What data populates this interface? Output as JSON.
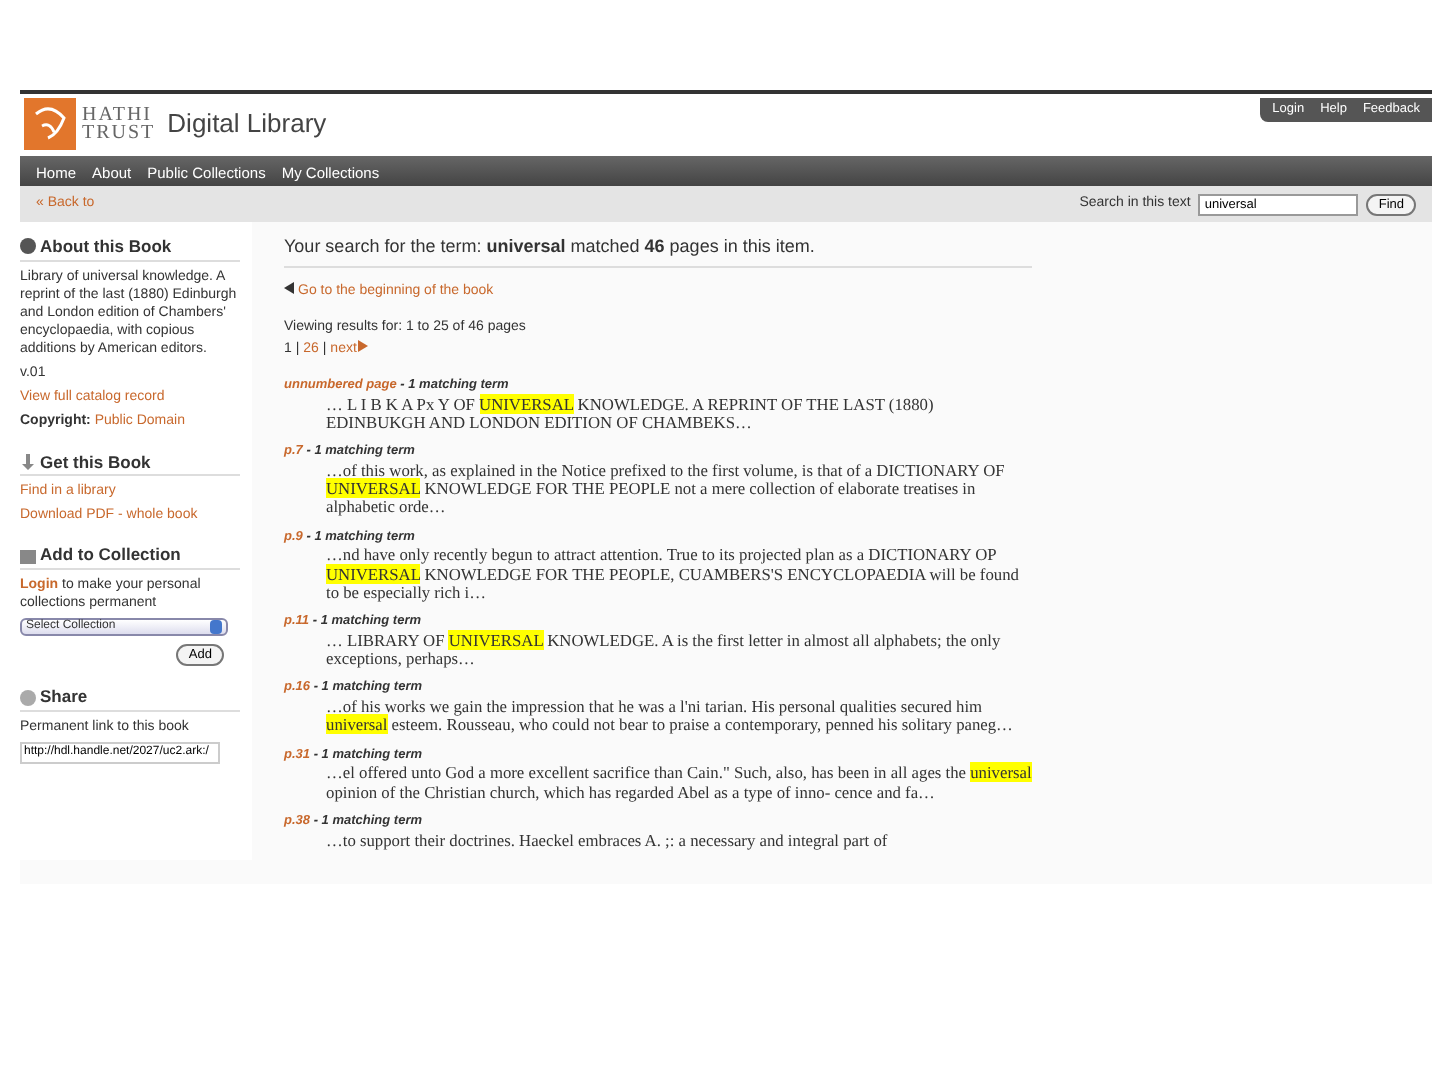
{
  "header": {
    "logo_top": "HATHI",
    "logo_bottom": "TRUST",
    "title": "Digital Library",
    "utility_links": [
      "Login",
      "Help",
      "Feedback"
    ]
  },
  "nav": [
    "Home",
    "About",
    "Public Collections",
    "My Collections"
  ],
  "subbar": {
    "back": "« Back to",
    "search_label": "Search in this text",
    "search_value": "universal",
    "find_button": "Find"
  },
  "sidebar": {
    "about": {
      "heading": "About this Book",
      "description": "Library of universal knowledge. A reprint of the last (1880) Edinburgh and London edition of Chambers' encyclopaedia, with copious additions by American editors.",
      "volume": "v.01",
      "catalog_link": "View full catalog record",
      "copyright_label": "Copyright:",
      "copyright_value": "Public Domain"
    },
    "get": {
      "heading": "Get this Book",
      "links": [
        "Find in a library",
        "Download PDF - whole book"
      ]
    },
    "collection": {
      "heading": "Add to Collection",
      "login": "Login",
      "text": "to make your personal collections permanent",
      "select": "Select Collection",
      "add_button": "Add"
    },
    "share": {
      "heading": "Share",
      "label": "Permanent link to this book",
      "link": "http://hdl.handle.net/2027/uc2.ark:/"
    }
  },
  "results": {
    "summary": "Your search for the term: **universal** matched **46** pages in this item.",
    "beginning_link": "Go to the beginning of the book",
    "viewing": "Viewing results for: 1 to 25 of 46 pages",
    "pages": [
      {
        "label": "1",
        "selected": true
      },
      {
        "label": "26",
        "selected": false
      }
    ],
    "separator": "|",
    "next": "next",
    "items": [
      {
        "page": "unnumbered page",
        "count": "- 1 matching term",
        "before": "… L I B K A Px Y OF ",
        "term": "UNIVERSAL",
        "after": " KNOWLEDGE. A REPRINT OF THE LAST (1880) EDINBUKGH AND LONDON EDITION OF CHAMBEKS…"
      },
      {
        "page": "p.7",
        "count": "- 1 matching term",
        "before": "…of this work, as explained in the Notice prefixed to the first volume, is that of a DICTIONARY OF ",
        "term": "UNIVERSAL",
        "after": " KNOWLEDGE FOR THE PEOPLE not a mere collection of elaborate treatises in alphabetic orde…"
      },
      {
        "page": "p.9",
        "count": "- 1 matching term",
        "before": "…nd have only recently begun to attract attention. True to its projected plan as a DICTIONARY OP ",
        "term": "UNIVERSAL",
        "after": " KNOWLEDGE FOR THE PEOPLE, CUAMBERS'S ENCYCLOPAEDIA will be found to be especially rich i…"
      },
      {
        "page": "p.11",
        "count": "- 1 matching term",
        "before": "… LIBRARY OF ",
        "term": "UNIVERSAL",
        "after": " KNOWLEDGE. A is the first letter in almost all alphabets; the only exceptions, perhaps…"
      },
      {
        "page": "p.16",
        "count": "- 1 matching term",
        "before": "…of his works we gain the impression that he was a l'ni tarian. His personal qualities secured him ",
        "term": "universal",
        "after": " esteem. Rousseau, who could not bear to praise a contemporary, penned his solitary paneg…"
      },
      {
        "page": "p.31",
        "count": "- 1 matching term",
        "before": "…el offered unto God a more excellent sacrifice than Cain.\" Such, also, has been in all ages the ",
        "term": "universal",
        "after": " opinion of the Christian church, which has regarded Abel as a type of inno- cence and fa…"
      },
      {
        "page": "p.38",
        "count": "- 1 matching term",
        "before": "…to support their doctrines. Haeckel embraces A. ;: a necessary and integral part of"
      }
    ]
  }
}
